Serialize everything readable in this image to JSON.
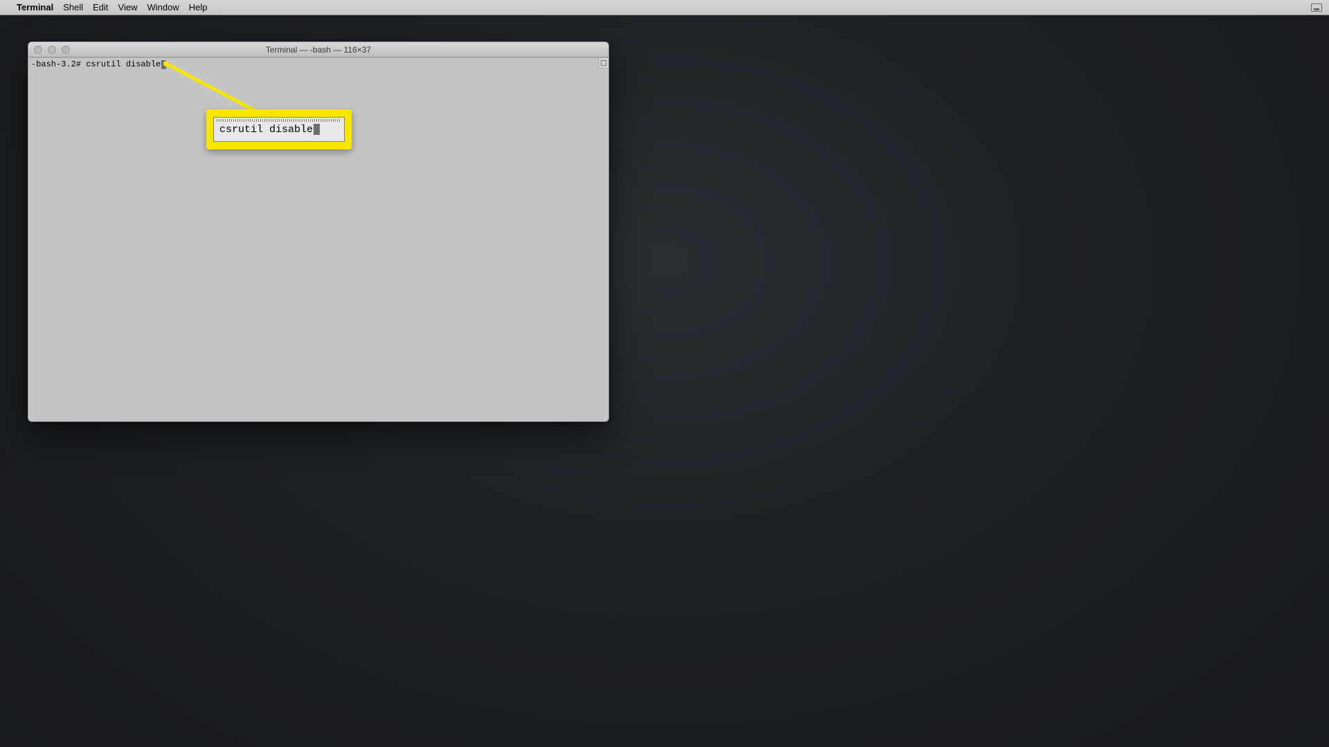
{
  "menubar": {
    "app_name": "Terminal",
    "items": [
      "Shell",
      "Edit",
      "View",
      "Window",
      "Help"
    ]
  },
  "window": {
    "title": "Terminal — -bash — 116×37"
  },
  "terminal": {
    "prompt": "-bash-3.2# ",
    "command": "csrutil disable"
  },
  "callout": {
    "text": "csrutil disable"
  }
}
